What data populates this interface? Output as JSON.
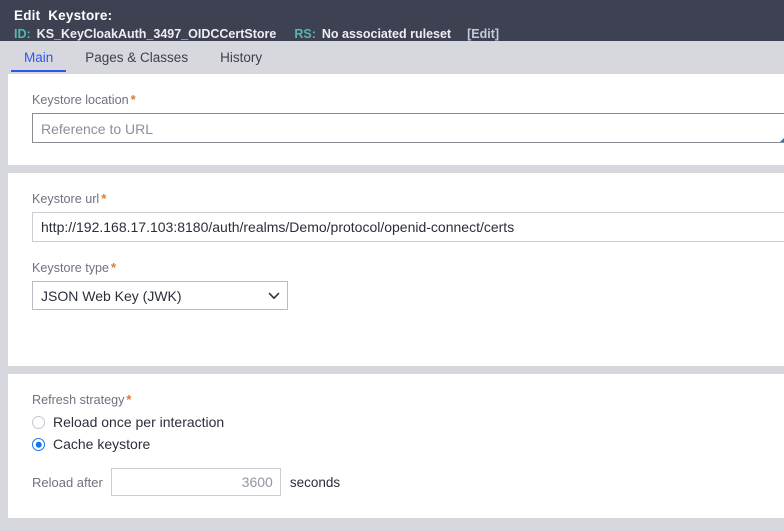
{
  "header": {
    "title": "Edit  Keystore:",
    "id_label": "ID:",
    "id_value": "KS_KeyCloakAuth_3497_OIDCCertStore",
    "rs_label": "RS:",
    "rs_value": "No associated ruleset",
    "edit_link": "[Edit]",
    "bg_color": "#3d4152",
    "key_color": "#55b8ad"
  },
  "tabs": [
    {
      "label": "Main",
      "active": true
    },
    {
      "label": "Pages & Classes",
      "active": false
    },
    {
      "label": "History",
      "active": false
    }
  ],
  "form": {
    "keystore_location": {
      "label": "Keystore location",
      "required_marker": "*",
      "value": "Reference to URL"
    },
    "keystore_url": {
      "label": "Keystore url",
      "required_marker": "*",
      "value": "http://192.168.17.103:8180/auth/realms/Demo/protocol/openid-connect/certs"
    },
    "keystore_type": {
      "label": "Keystore type",
      "required_marker": "*",
      "selected": "JSON Web Key (JWK)",
      "options": [
        "JSON Web Key (JWK)"
      ],
      "chevron_icon": "chevron-down-icon"
    },
    "refresh_strategy": {
      "label": "Refresh strategy",
      "required_marker": "*",
      "options": [
        {
          "label": "Reload once per interaction",
          "selected": false
        },
        {
          "label": "Cache keystore",
          "selected": true
        }
      ],
      "accent_color": "#1b72e8"
    },
    "reload_after": {
      "label": "Reload after",
      "value": "3600",
      "unit": "seconds"
    }
  },
  "colors": {
    "required_asterisk": "#e8762c",
    "active_tab": "#2f55f0",
    "page_bg": "#d7d8de",
    "panel_bg": "#ffffff"
  }
}
